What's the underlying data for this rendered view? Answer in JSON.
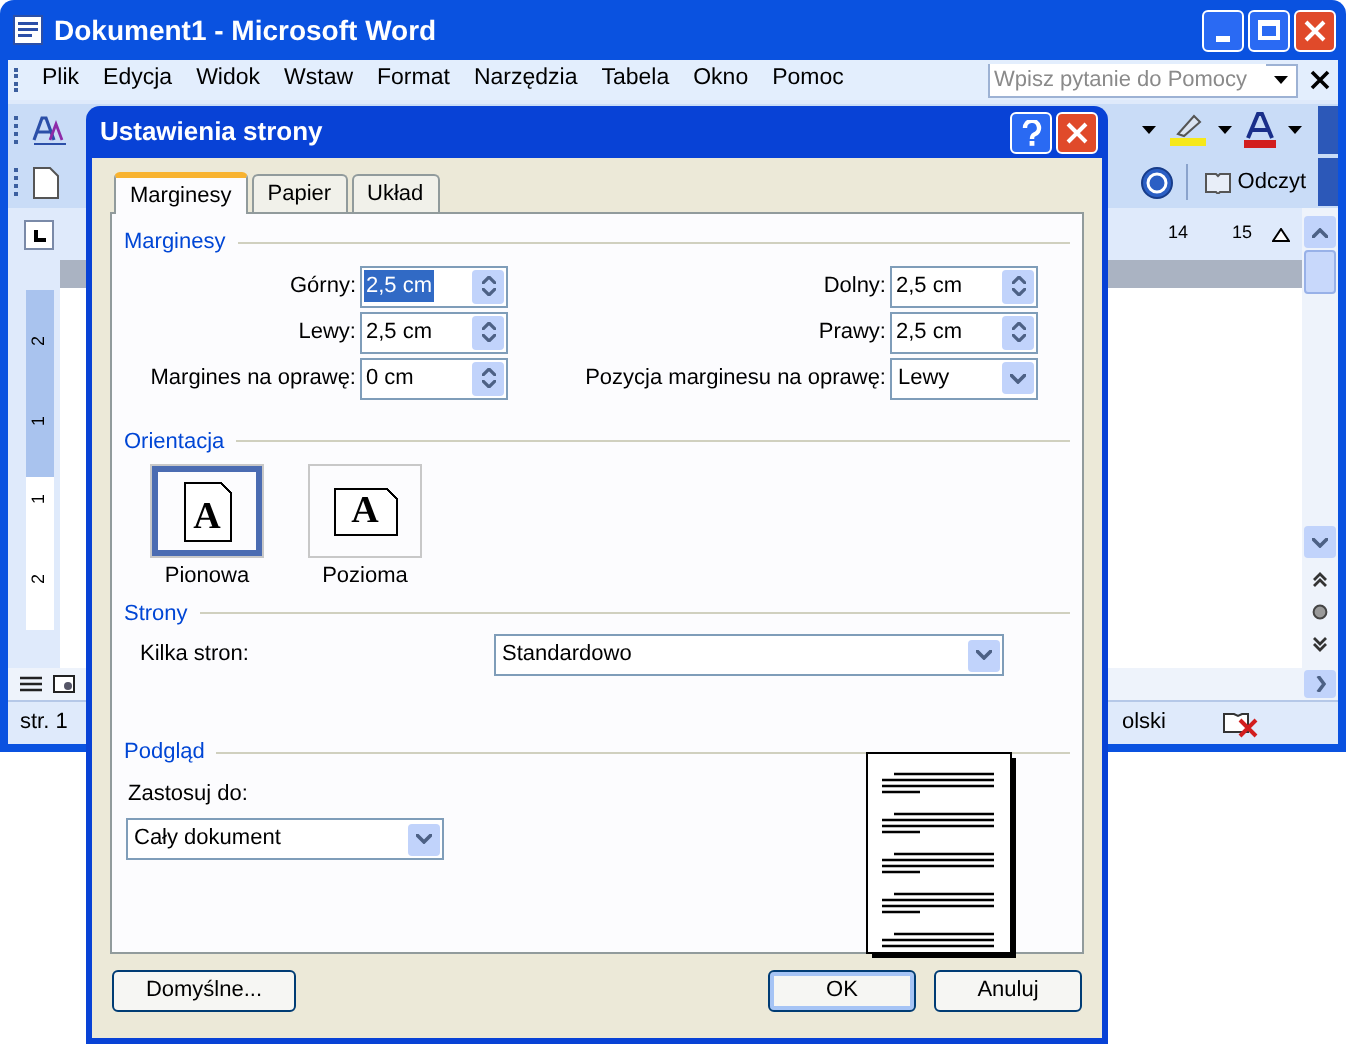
{
  "window": {
    "title": "Dokument1 - Microsoft Word"
  },
  "menu": [
    "Plik",
    "Edycja",
    "Widok",
    "Wstaw",
    "Format",
    "Narzędzia",
    "Tabela",
    "Okno",
    "Pomoc"
  ],
  "help_box": {
    "placeholder": "Wpisz pytanie do Pomocy"
  },
  "toolbar": {
    "read_button": "Odczyt"
  },
  "ruler": {
    "horizontal_labels": [
      "14",
      "15"
    ],
    "vertical_labels": [
      "2",
      "1",
      "1",
      "2"
    ]
  },
  "status_bar": {
    "page": "str. 1",
    "language": "olski"
  },
  "dialog": {
    "title": "Ustawienia strony",
    "tabs": [
      {
        "label": "Marginesy",
        "selected": true
      },
      {
        "label": "Papier",
        "selected": false
      },
      {
        "label": "Układ",
        "selected": false
      }
    ],
    "margins": {
      "heading": "Marginesy",
      "fields": [
        {
          "label": "Górny:",
          "value": "2,5 cm",
          "kind": "spin",
          "selected": true
        },
        {
          "label": "Dolny:",
          "value": "2,5 cm",
          "kind": "spin",
          "selected": false
        },
        {
          "label": "Lewy:",
          "value": "2,5 cm",
          "kind": "spin",
          "selected": false
        },
        {
          "label": "Prawy:",
          "value": "2,5 cm",
          "kind": "spin",
          "selected": false
        },
        {
          "label": "Margines na oprawę:",
          "value": "0 cm",
          "kind": "spin",
          "selected": false
        },
        {
          "label": "Pozycja marginesu na oprawę:",
          "value": "Lewy",
          "kind": "dropdown",
          "selected": false
        }
      ]
    },
    "orientation": {
      "heading": "Orientacja",
      "options": [
        {
          "label": "Pionowa",
          "kind": "portrait",
          "glyph": "A",
          "selected": true
        },
        {
          "label": "Pozioma",
          "kind": "landscape",
          "glyph": "A",
          "selected": false
        }
      ]
    },
    "pages": {
      "heading": "Strony",
      "label": "Kilka stron:",
      "value": "Standardowo"
    },
    "preview": {
      "heading": "Podgląd",
      "apply_label": "Zastosuj do:",
      "apply_value": "Cały dokument"
    },
    "buttons": [
      {
        "label": "Domyślne...",
        "selected": false
      },
      {
        "label": "OK",
        "selected": true
      },
      {
        "label": "Anuluj",
        "selected": false
      }
    ]
  }
}
